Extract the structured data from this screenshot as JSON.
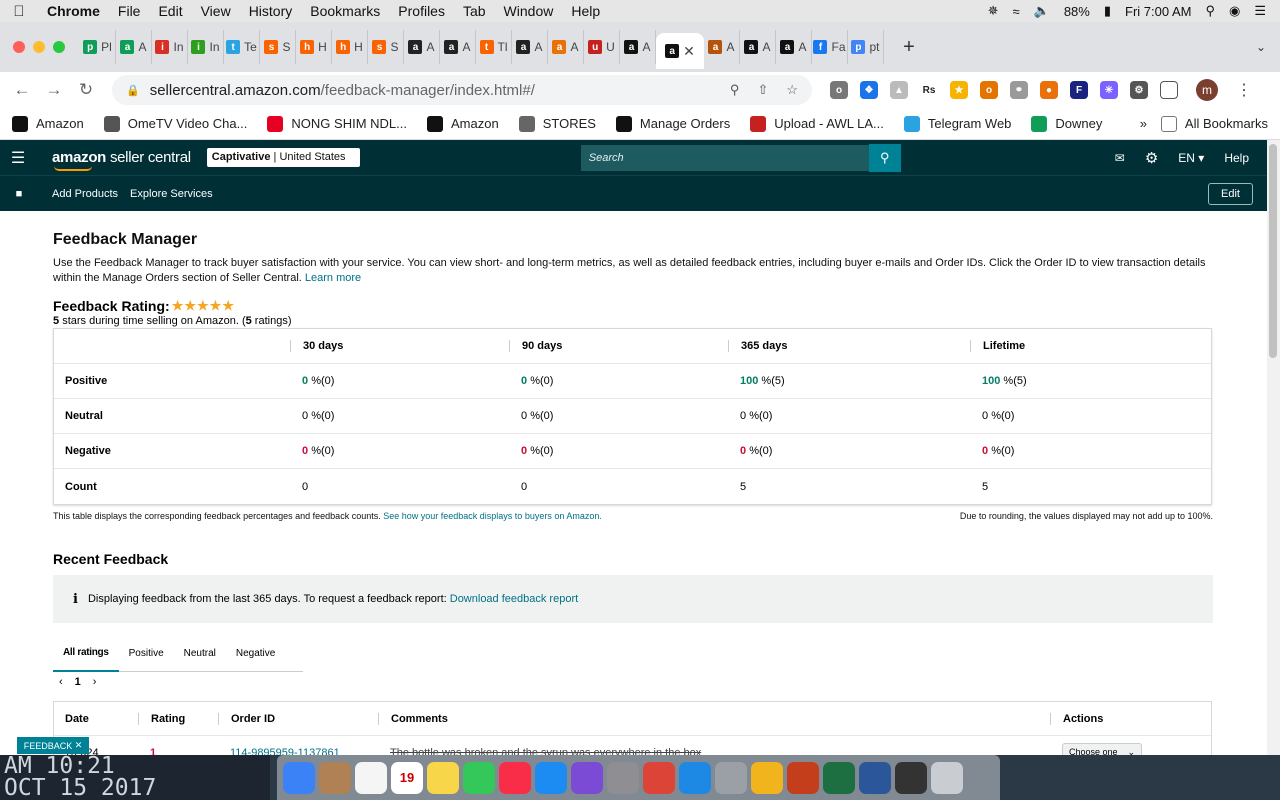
{
  "menubar": {
    "app": "Chrome",
    "items": [
      "File",
      "Edit",
      "View",
      "History",
      "Bookmarks",
      "Profiles",
      "Tab",
      "Window",
      "Help"
    ],
    "battery": "88%",
    "clock": "Fri 7:00 AM"
  },
  "tabs": [
    {
      "label": "Pl",
      "icon": "green-sheet-icon",
      "color": "#0f9d58"
    },
    {
      "label": "A",
      "icon": "green-sheet-icon",
      "color": "#0f9d58"
    },
    {
      "label": "In",
      "icon": "gmail-icon",
      "color": "#d93025"
    },
    {
      "label": "In",
      "icon": "quickbooks-icon",
      "color": "#2ca01c"
    },
    {
      "label": "Te",
      "icon": "telegram-icon",
      "color": "#2aa3e0"
    },
    {
      "label": "S",
      "icon": "home-depot-icon",
      "color": "#f96302"
    },
    {
      "label": "H",
      "icon": "home-depot-icon",
      "color": "#f96302"
    },
    {
      "label": "H",
      "icon": "home-depot-icon",
      "color": "#f96302"
    },
    {
      "label": "S",
      "icon": "home-depot-icon",
      "color": "#f96302"
    },
    {
      "label": "A",
      "icon": "amazon-icon",
      "color": "#222"
    },
    {
      "label": "A",
      "icon": "amazon-icon",
      "color": "#222"
    },
    {
      "label": "Tl",
      "icon": "home-depot-icon",
      "color": "#f96302"
    },
    {
      "label": "A",
      "icon": "amazon-icon",
      "color": "#222"
    },
    {
      "label": "A",
      "icon": "pencil-icon",
      "color": "#e8710a"
    },
    {
      "label": "U",
      "icon": "shield-icon",
      "color": "#c5221f"
    },
    {
      "label": "A",
      "icon": "amazon-icon",
      "color": "#111"
    }
  ],
  "tabs_after": [
    {
      "label": "A",
      "icon": "amazon-icon",
      "color": "#b45309"
    },
    {
      "label": "A",
      "icon": "amazon-icon",
      "color": "#111"
    },
    {
      "label": "A",
      "icon": "amazon-icon",
      "color": "#111"
    },
    {
      "label": "Fa",
      "icon": "facebook-icon",
      "color": "#1877f2"
    },
    {
      "label": "pt",
      "icon": "google-icon",
      "color": "#4285f4"
    }
  ],
  "url": {
    "host": "sellercentral.amazon.com",
    "path": "/feedback-manager/index.html#/"
  },
  "bookmarks": [
    {
      "label": "Amazon",
      "icon": "amazon-icon",
      "color": "#111"
    },
    {
      "label": "OmeTV Video Cha...",
      "icon": "globe-icon",
      "color": "#555"
    },
    {
      "label": "NONG SHIM NDL...",
      "icon": "pinterest-icon",
      "color": "#e60023"
    },
    {
      "label": "Amazon",
      "icon": "amazon-icon",
      "color": "#111"
    },
    {
      "label": "STORES",
      "icon": "folder-icon",
      "color": "#666"
    },
    {
      "label": "Manage Orders",
      "icon": "amazon-icon",
      "color": "#111"
    },
    {
      "label": "Upload - AWL LA...",
      "icon": "shield-icon",
      "color": "#c5221f"
    },
    {
      "label": "Telegram Web",
      "icon": "telegram-icon",
      "color": "#2aa3e0"
    },
    {
      "label": "Downey",
      "icon": "green-sheet-icon",
      "color": "#0f9d58"
    }
  ],
  "bookmarks_more": "»",
  "bookmarks_all": "All Bookmarks",
  "sc": {
    "logo_main": "amazon",
    "logo_sub": "seller central",
    "store_name": "Captivative",
    "store_region": "| United States",
    "search_placeholder": "Search",
    "lang": "EN",
    "help": "Help",
    "sub_links": [
      "Add Products",
      "Explore Services"
    ],
    "edit": "Edit"
  },
  "page": {
    "title": "Feedback Manager",
    "intro": "Use the Feedback Manager to track buyer satisfaction with your service. You can view short- and long-term metrics, as well as detailed feedback entries, including buyer e-mails and Order IDs. Click the Order ID to view transaction details within the Manage Orders section of Seller Central.",
    "learn_more": "Learn more",
    "rating_label": "Feedback Rating:",
    "stars_value": 5,
    "stars_max": 5,
    "rating_stars": "5",
    "rating_text": "stars during time selling on Amazon. (",
    "rating_count": "5",
    "rating_text_end": "ratings)"
  },
  "metrics": {
    "headers": [
      "",
      "30 days",
      "90 days",
      "365 days",
      "Lifetime"
    ],
    "rows": [
      {
        "label": "Positive",
        "cells": [
          [
            "0",
            "%(0)",
            "g"
          ],
          [
            "0",
            "%(0)",
            "g"
          ],
          [
            "100",
            "%(5)",
            "g"
          ],
          [
            "100",
            "%(5)",
            "g"
          ]
        ]
      },
      {
        "label": "Neutral",
        "cells": [
          [
            "0",
            "%(0)",
            ""
          ],
          [
            "0",
            "%(0)",
            ""
          ],
          [
            "0",
            "%(0)",
            ""
          ],
          [
            "0",
            "%(0)",
            ""
          ]
        ]
      },
      {
        "label": "Negative",
        "cells": [
          [
            "0",
            "%(0)",
            "r"
          ],
          [
            "0",
            "%(0)",
            "r"
          ],
          [
            "0",
            "%(0)",
            "r"
          ],
          [
            "0",
            "%(0)",
            "r"
          ]
        ]
      },
      {
        "label": "Count",
        "cells": [
          [
            "",
            "0",
            ""
          ],
          [
            "",
            "0",
            ""
          ],
          [
            "",
            "5",
            ""
          ],
          [
            "",
            "5",
            ""
          ]
        ]
      }
    ],
    "note_left": "This table displays the corresponding feedback percentages and feedback counts.",
    "note_link": "See how your feedback displays to buyers on Amazon.",
    "note_right": "Due to rounding, the values displayed may not add up to 100%."
  },
  "recent": {
    "title": "Recent Feedback",
    "info": "Displaying feedback from the last 365 days. To request a feedback report:",
    "info_link": "Download feedback report",
    "tabs": [
      "All ratings",
      "Positive",
      "Neutral",
      "Negative"
    ],
    "page": "1",
    "headers": [
      "Date",
      "Rating",
      "Order ID",
      "Comments",
      "Actions"
    ],
    "rows": [
      {
        "date": "7/2024",
        "rating": "1",
        "order": "114-9895959-1137861",
        "comment": "The bottle was broken and the syrup was everywhere in the box",
        "action": "Choose one"
      }
    ]
  },
  "feedback_tag": "FEEDBACK",
  "desktop_clock": [
    "AM 10:21",
    "OCT 15 2017"
  ],
  "dock": [
    {
      "name": "finder-icon",
      "color": "#3b82f6"
    },
    {
      "name": "contacts-icon",
      "color": "#b08155"
    },
    {
      "name": "reminders-icon",
      "color": "#f5f5f5"
    },
    {
      "name": "calendar-icon",
      "color": "#ffffff",
      "text": "19"
    },
    {
      "name": "notes-icon",
      "color": "#f7d64a"
    },
    {
      "name": "facetime-icon",
      "color": "#34c759"
    },
    {
      "name": "music-icon",
      "color": "#fa2d48"
    },
    {
      "name": "app-store-icon",
      "color": "#1c8cf3"
    },
    {
      "name": "siri-icon",
      "color": "#7b4bd6"
    },
    {
      "name": "system-preferences-icon",
      "color": "#8e8e93"
    },
    {
      "name": "chrome-icon",
      "color": "#db4437"
    },
    {
      "name": "safari-icon",
      "color": "#1e88e5"
    },
    {
      "name": "launchpad-icon",
      "color": "#9aa0a6"
    },
    {
      "name": "photos-icon",
      "color": "#f2b41c"
    },
    {
      "name": "powerpoint-icon",
      "color": "#c43e1c"
    },
    {
      "name": "excel-icon",
      "color": "#1d6f42"
    },
    {
      "name": "word-icon",
      "color": "#2b579a"
    },
    {
      "name": "terminal-icon",
      "color": "#333333"
    },
    {
      "name": "trash-icon",
      "color": "#c9ccd1"
    }
  ]
}
